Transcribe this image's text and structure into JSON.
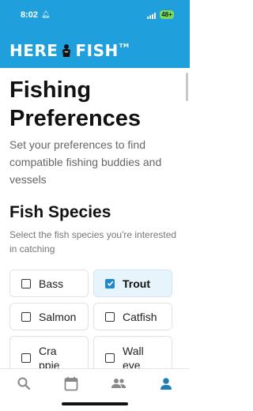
{
  "status_bar": {
    "time": "8:02",
    "battery": "48+"
  },
  "app": {
    "logo_left": "HERE",
    "logo_right": "FISH",
    "logo_tm": "TM"
  },
  "page": {
    "title": "Fishing Preferences",
    "subtitle": "Set your preferences to find compatible fishing buddies and vessels"
  },
  "fish_species": {
    "title": "Fish Species",
    "subtitle": "Select the fish species you're interested in catching",
    "options": [
      {
        "label": "Bass",
        "checked": false
      },
      {
        "label": "Trout",
        "checked": true
      },
      {
        "label": "Salmon",
        "checked": false
      },
      {
        "label": "Catfish",
        "checked": false
      },
      {
        "label": "Crappie",
        "checked": false
      },
      {
        "label": "Walleye",
        "checked": false
      }
    ]
  },
  "tabs": [
    {
      "icon": "search-icon",
      "active": false
    },
    {
      "icon": "calendar-icon",
      "active": false
    },
    {
      "icon": "people-icon",
      "active": false
    },
    {
      "icon": "profile-icon",
      "active": true
    }
  ],
  "colors": {
    "brand": "#1fa0dd",
    "active_tab": "#1b7fb7",
    "inactive_tab": "#888888",
    "checkbox_on": "#1b8ad0"
  }
}
